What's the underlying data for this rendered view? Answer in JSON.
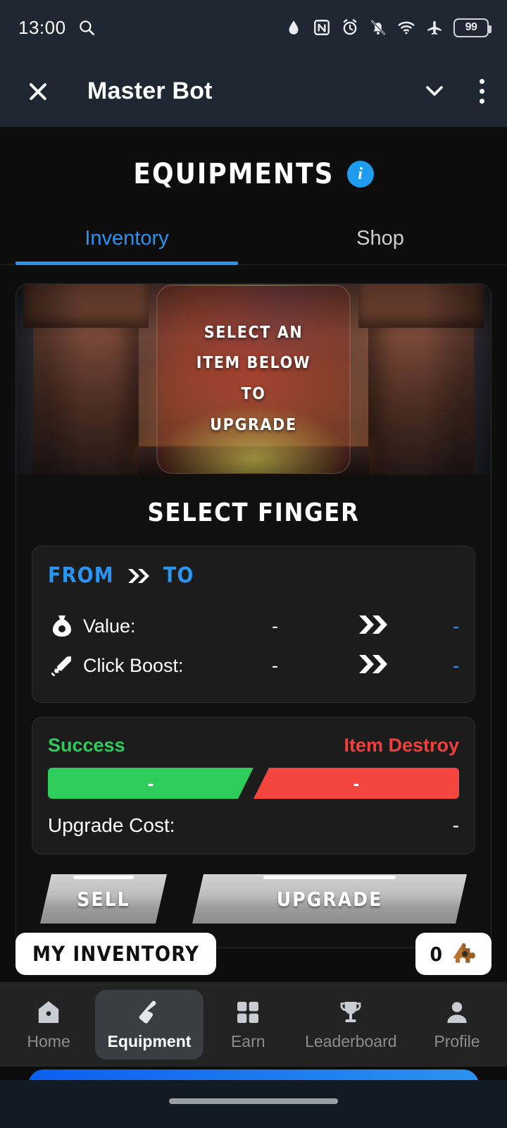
{
  "status_bar": {
    "time": "13:00",
    "battery_level": "99",
    "icons": [
      "search-icon",
      "water-drop-icon",
      "nfc-icon",
      "alarm-icon",
      "notifications-muted-icon",
      "wifi-icon",
      "airplane-mode-icon",
      "battery-icon"
    ]
  },
  "app_bar": {
    "title": "Master Bot",
    "close_icon": "close-icon",
    "collapse_icon": "chevron-down-icon",
    "overflow_icon": "kebab-menu-icon"
  },
  "page": {
    "title": "EQUIPMENTS",
    "info_badge": "i",
    "tabs": [
      {
        "label": "Inventory",
        "active": true
      },
      {
        "label": "Shop",
        "active": false
      }
    ]
  },
  "forge": {
    "prompt_lines": [
      "SELECT AN",
      "ITEM BELOW",
      "TO",
      "UPGRADE"
    ]
  },
  "upgrade": {
    "heading": "SELECT FINGER",
    "from_label": "FROM",
    "to_label": "TO",
    "stats": [
      {
        "icon": "money-bag-icon",
        "name": "Value:",
        "from": "-",
        "to": "-"
      },
      {
        "icon": "sword-icon",
        "name": "Click Boost:",
        "from": "-",
        "to": "-"
      }
    ],
    "risk": {
      "success_label": "Success",
      "destroy_label": "Item Destroy",
      "success_value": "-",
      "destroy_value": "-",
      "success_pct": 50,
      "success_color": "#2ecc5b",
      "destroy_color": "#f4463f"
    },
    "cost_label": "Upgrade Cost:",
    "cost_value": "-",
    "sell_button": "SELL",
    "upgrade_button": "UPGRADE"
  },
  "inventory": {
    "title": "MY INVENTORY",
    "count": "0",
    "currency_icon": "puzzle-piece-icon"
  },
  "bottom_nav": {
    "items": [
      {
        "label": "Home",
        "icon": "home-icon",
        "active": false
      },
      {
        "label": "Equipment",
        "icon": "pointing-hand-icon",
        "active": true
      },
      {
        "label": "Earn",
        "icon": "grid-squares-icon",
        "active": false
      },
      {
        "label": "Leaderboard",
        "icon": "trophy-icon",
        "active": false
      },
      {
        "label": "Profile",
        "icon": "person-icon",
        "active": false
      }
    ]
  },
  "theme": {
    "accent_blue": "#2b93f0",
    "app_bar_bg": "#1f2733",
    "page_bg": "#0d0d0d"
  }
}
